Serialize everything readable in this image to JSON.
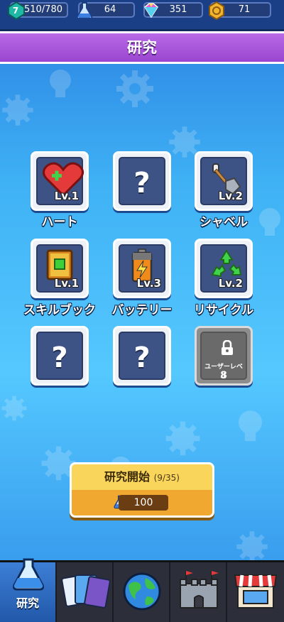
{
  "resources": {
    "player_level": "7",
    "energy": "510/780",
    "potion": "64",
    "gem": "351",
    "coin": "71"
  },
  "title": "研究",
  "tiles": [
    {
      "label": "ハート",
      "level": "Lv.1",
      "icon": "heart-icon"
    },
    {
      "label": "",
      "level": "",
      "icon": "question-mark"
    },
    {
      "label": "シャベル",
      "level": "Lv.2",
      "icon": "shovel-icon"
    },
    {
      "label": "スキルブック",
      "level": "Lv.1",
      "icon": "skill-book-icon"
    },
    {
      "label": "バッテリー",
      "level": "Lv.3",
      "icon": "battery-icon"
    },
    {
      "label": "リサイクル",
      "level": "Lv.2",
      "icon": "recycle-icon"
    },
    {
      "label": "",
      "level": "",
      "icon": "question-mark"
    },
    {
      "label": "",
      "level": "",
      "icon": "question-mark"
    },
    {
      "label": "",
      "level": "",
      "icon": "lock-icon",
      "lock_caption": "ユーザーレベル",
      "lock_level": "8"
    }
  ],
  "question_mark": "?",
  "start_button": {
    "label": "研究開始",
    "count": "(9/35)",
    "cost": "100"
  },
  "nav": {
    "research_label": "研究"
  },
  "colors": {
    "title_band": "#a955dc",
    "button_yellow": "#f9d55b",
    "button_orange": "#f0a830",
    "nav_active": "#2f6cc0"
  }
}
